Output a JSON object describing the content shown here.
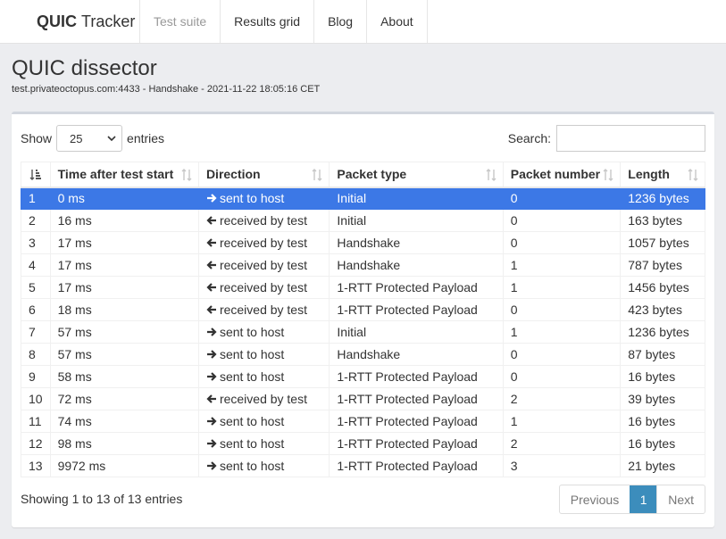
{
  "nav": {
    "brand_bold": "QUIC",
    "brand_rest": "Tracker",
    "items": [
      "Test suite",
      "Results grid",
      "Blog",
      "About"
    ]
  },
  "title": "QUIC dissector",
  "subtitle": "test.privateoctopus.com:4433 - Handshake - 2021-11-22 18:05:16 CET",
  "controls": {
    "show_label": "Show",
    "entries_value": "25",
    "entries_label": "entries",
    "search_label": "Search:"
  },
  "table": {
    "columns": [
      "#",
      "Time after test start",
      "Direction",
      "Packet type",
      "Packet number",
      "Length"
    ],
    "rows": [
      [
        "1",
        "0 ms",
        "sent to host",
        "Initial",
        "0",
        "1236 bytes"
      ],
      [
        "2",
        "16 ms",
        "received by test",
        "Initial",
        "0",
        "163 bytes"
      ],
      [
        "3",
        "17 ms",
        "received by test",
        "Handshake",
        "0",
        "1057 bytes"
      ],
      [
        "4",
        "17 ms",
        "received by test",
        "Handshake",
        "1",
        "787 bytes"
      ],
      [
        "5",
        "17 ms",
        "received by test",
        "1-RTT Protected Payload",
        "1",
        "1456 bytes"
      ],
      [
        "6",
        "18 ms",
        "received by test",
        "1-RTT Protected Payload",
        "0",
        "423 bytes"
      ],
      [
        "7",
        "57 ms",
        "sent to host",
        "Initial",
        "1",
        "1236 bytes"
      ],
      [
        "8",
        "57 ms",
        "sent to host",
        "Handshake",
        "0",
        "87 bytes"
      ],
      [
        "9",
        "58 ms",
        "sent to host",
        "1-RTT Protected Payload",
        "0",
        "16 bytes"
      ],
      [
        "10",
        "72 ms",
        "received by test",
        "1-RTT Protected Payload",
        "2",
        "39 bytes"
      ],
      [
        "11",
        "74 ms",
        "sent to host",
        "1-RTT Protected Payload",
        "1",
        "16 bytes"
      ],
      [
        "12",
        "98 ms",
        "sent to host",
        "1-RTT Protected Payload",
        "2",
        "16 bytes"
      ],
      [
        "13",
        "9972 ms",
        "sent to host",
        "1-RTT Protected Payload",
        "3",
        "21 bytes"
      ]
    ]
  },
  "footer": {
    "info": "Showing 1 to 13 of 13 entries",
    "prev": "Previous",
    "page": "1",
    "next": "Next"
  },
  "colors": {
    "selected_row": "#3c78e6",
    "page_active": "#3c8dbc"
  }
}
